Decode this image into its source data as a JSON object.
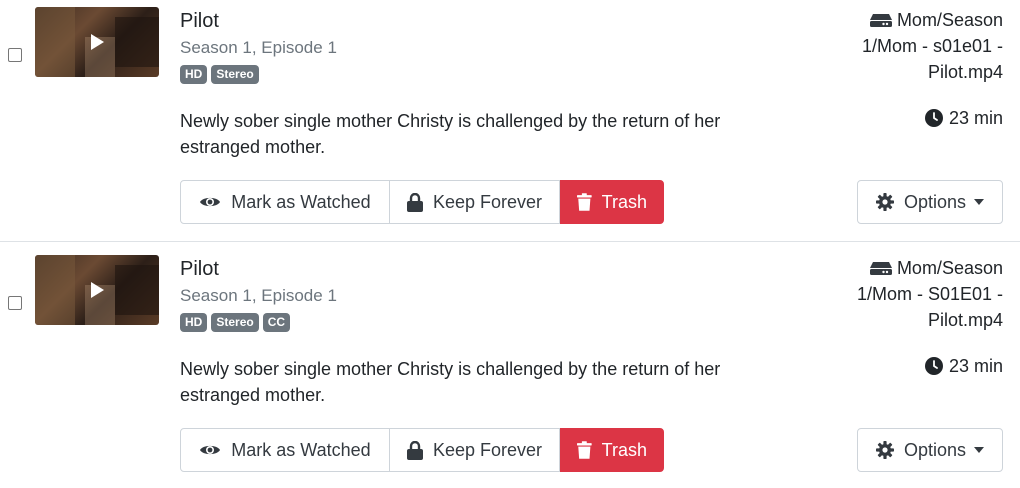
{
  "episodes": [
    {
      "title": "Pilot",
      "subtitle": "Season 1, Episode 1",
      "badges": [
        "HD",
        "Stereo"
      ],
      "summary": "Newly sober single mother Christy is challenged by the return of her estranged mother.",
      "file_path": "Mom/Season 1/Mom - s01e01 - Pilot.mp4",
      "duration": "23 min",
      "actions": {
        "mark_watched": "Mark as Watched",
        "keep_forever": "Keep Forever",
        "trash": "Trash",
        "options": "Options"
      },
      "icons": {
        "thumbnail": "play-icon",
        "file": "hdd-icon",
        "duration": "clock-icon",
        "mark_watched": "eye-icon",
        "keep_forever": "lock-icon",
        "trash": "trash-icon",
        "options": "gear-icon"
      }
    },
    {
      "title": "Pilot",
      "subtitle": "Season 1, Episode 1",
      "badges": [
        "HD",
        "Stereo",
        "CC"
      ],
      "summary": "Newly sober single mother Christy is challenged by the return of her estranged mother.",
      "file_path": "Mom/Season 1/Mom - S01E01 - Pilot.mp4",
      "duration": "23 min",
      "actions": {
        "mark_watched": "Mark as Watched",
        "keep_forever": "Keep Forever",
        "trash": "Trash",
        "options": "Options"
      },
      "icons": {
        "thumbnail": "play-icon",
        "file": "hdd-icon",
        "duration": "clock-icon",
        "mark_watched": "eye-icon",
        "keep_forever": "lock-icon",
        "trash": "trash-icon",
        "options": "gear-icon"
      }
    }
  ],
  "colors": {
    "danger": "#dc3545",
    "badge": "#6c757d",
    "muted_text": "#6c757d",
    "border": "#ced4da"
  }
}
